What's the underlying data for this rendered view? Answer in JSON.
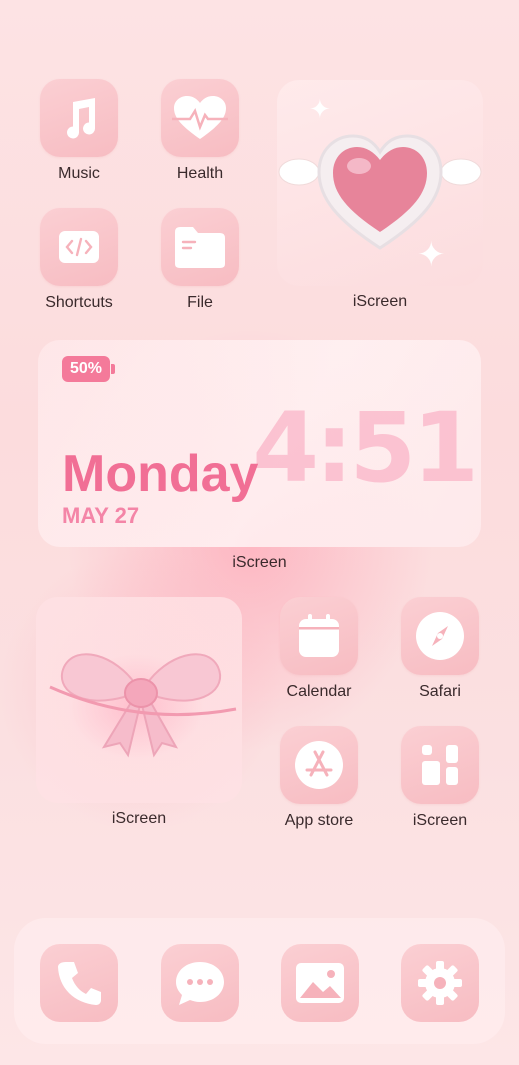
{
  "apps": {
    "music": "Music",
    "health": "Health",
    "shortcuts": "Shortcuts",
    "file": "File",
    "calendar": "Calendar",
    "safari": "Safari",
    "app_store": "App store",
    "iscreen_app": "iScreen"
  },
  "widgets": {
    "heart_label": "iScreen",
    "clock_label": "iScreen",
    "bow_label": "iScreen",
    "battery": "50%",
    "time": "4:51",
    "day": "Monday",
    "date": "MAY 27"
  },
  "dock": [
    "phone-icon",
    "messages-icon",
    "photos-icon",
    "settings-icon"
  ],
  "colors": {
    "tile": "#f7bcc2",
    "accent": "#f16f95",
    "background": "#fcdcdd"
  }
}
